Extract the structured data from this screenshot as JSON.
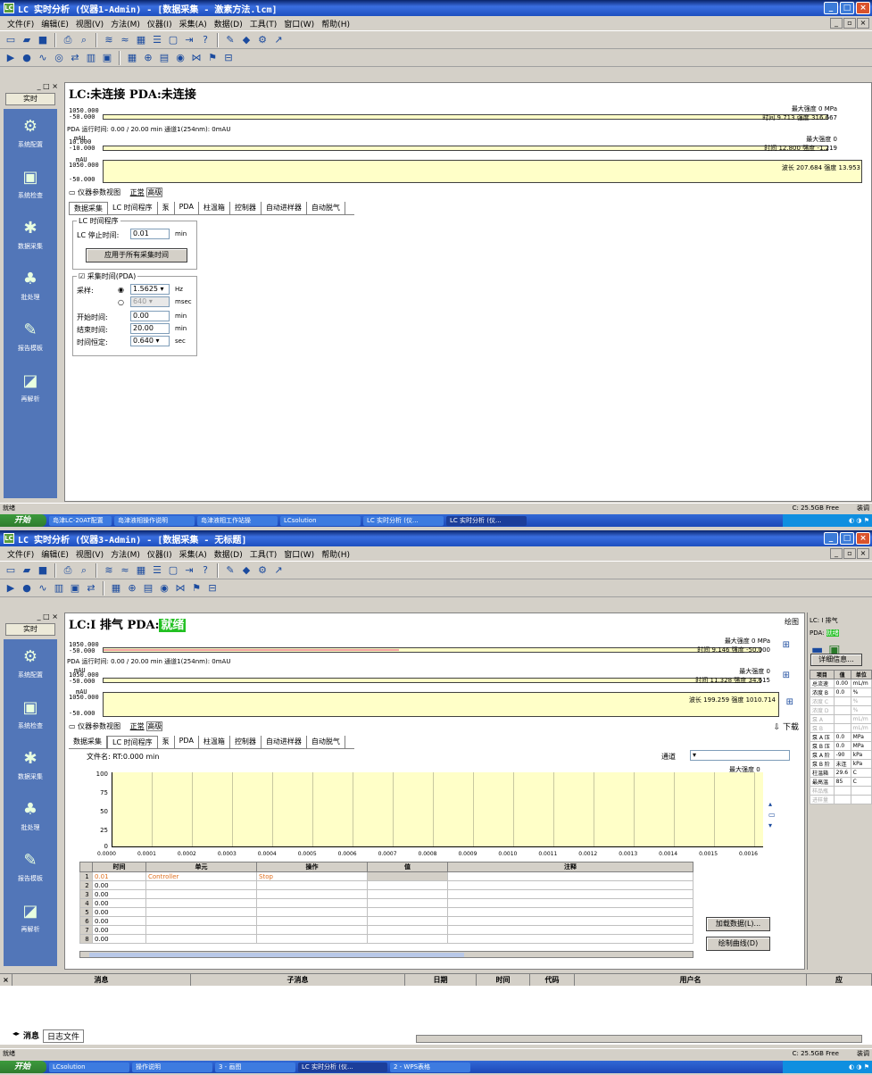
{
  "w1": {
    "title": "LC 实时分析 (仪器1-Admin) - [数据采集 - 激素方法.lcm]",
    "menu": [
      "文件(F)",
      "编辑(E)",
      "视图(V)",
      "方法(M)",
      "仪器(I)",
      "采集(A)",
      "数据(D)",
      "工具(T)",
      "窗口(W)",
      "帮助(H)"
    ],
    "leftbar": {
      "tab": "实时",
      "items": [
        "系统配置",
        "系统检查",
        "数据采集",
        "批处理",
        "报告模板",
        "再解析"
      ]
    },
    "status_lc": "LC:未连接",
    "status_pda": "PDA:未连接",
    "strip1": {
      "ytop": "1050.000",
      "ybot": "-50.000",
      "readout_time": "时间",
      "time_val": "9.713",
      "intensity_lbl": "强度",
      "int_val": "316.667",
      "max_lbl": "最大强度",
      "max_val": "0",
      "unit": "MPa"
    },
    "runinfo": "PDA 运行时间: 0.00 / 20.00 min 通道1(254nm): 0mAU",
    "strip2": {
      "unit": "mAU",
      "ytop": "10.000",
      "ybot": "-10.000",
      "max_lbl": "最大强度",
      "max_val": "0",
      "time_lbl": "时间",
      "time_val": "12.800",
      "int_lbl": "强度",
      "int_val": "-1.219"
    },
    "strip3": {
      "unit": "mAU",
      "ytop": "1050.000",
      "ybot": "-50.000",
      "wl_lbl": "波长",
      "wl_val": "207.684",
      "int_lbl": "强度",
      "int_val": "13.953"
    },
    "params_title": "仪器参数视图",
    "mode_normal": "正常",
    "mode_adv": "高级",
    "tabs": [
      "数据采集",
      "LC 时间程序",
      "泵",
      "PDA",
      "柱温箱",
      "控制器",
      "自动进样器",
      "自动脱气"
    ],
    "lc_group": "LC 时间程序",
    "stop_time_lbl": "LC 停止时间:",
    "stop_time_val": "0.01",
    "min": "min",
    "apply_btn": "应用于所有采集时间",
    "pda_group": "采集时间(PDA)",
    "sampling_lbl": "采样:",
    "sampling_val": "1.5625",
    "hz": "Hz",
    "msec_val": "640",
    "msec": "msec",
    "start_lbl": "开始时间:",
    "start_val": "0.00",
    "end_lbl": "结束时间:",
    "end_val": "20.00",
    "const_lbl": "时间恒定:",
    "const_val": "0.640",
    "sec": "sec",
    "statusbar_left": "就绪",
    "statusbar_right": "C: 25.5GB Free",
    "statusbar_far": "装调",
    "taskbar": {
      "start": "开始",
      "tasks": [
        "岛津LC-20AT配置",
        "岛津液相操作说明",
        "岛津液相工作站操",
        "LCsolution",
        "LC 实时分析 (仪...",
        "LC 实时分析 (仪..."
      ]
    }
  },
  "w2": {
    "title": "LC 实时分析 (仪器3-Admin) - [数据采集 - 无标题]",
    "menu": [
      "文件(F)",
      "编辑(E)",
      "视图(V)",
      "方法(M)",
      "仪器(I)",
      "采集(A)",
      "数据(D)",
      "工具(T)",
      "窗口(W)",
      "帮助(H)"
    ],
    "leftbar": {
      "tab": "实时",
      "items": [
        "系统配置",
        "系统检查",
        "数据采集",
        "批处理",
        "报告模板",
        "再解析"
      ]
    },
    "status_lc": "LC:I 排气",
    "status_pda": "PDA:",
    "status_pda_ok": "就绪",
    "draw_btn": "绘图",
    "strip1": {
      "ytop": "1050.000",
      "ybot": "-50.000",
      "max_lbl": "最大强度",
      "max_val": "0",
      "unit": "MPa",
      "time_lbl": "时间",
      "time_val": "9.146",
      "int_lbl": "强度",
      "int_val": "-50.000"
    },
    "runinfo": "PDA 运行时间: 0.00 / 20.00 min 通道1(254nm): 0mAU",
    "strip2": {
      "unit": "mAU",
      "ytop": "1050.000",
      "ybot": "-50.000",
      "max_lbl": "最大强度",
      "max_val": "0",
      "time_lbl": "时间",
      "time_val": "11.328",
      "int_lbl": "强度",
      "int_val": "34.615"
    },
    "strip3": {
      "unit": "mAU",
      "ytop": "1050.000",
      "ybot": "-50.000",
      "wl_lbl": "波长",
      "wl_val": "199.259",
      "int_lbl": "强度",
      "int_val": "1010.714"
    },
    "params_title": "仪器参数视图",
    "mode_normal": "正常",
    "mode_adv": "高级",
    "download_btn": "下载",
    "tabs": [
      "数据采集",
      "LC 时间程序",
      "泵",
      "PDA",
      "柱温箱",
      "控制器",
      "自动进样器",
      "自动脱气"
    ],
    "file_lbl": "文件名: RT:0.000 min",
    "channel_lbl": "通道",
    "graph_max_lbl": "最大强度",
    "graph_max_val": "0",
    "graph_yticks": [
      "100",
      "75",
      "50",
      "25",
      "0"
    ],
    "graph_xticks": [
      "0.0000",
      "0.0001",
      "0.0002",
      "0.0003",
      "0.0004",
      "0.0005",
      "0.0006",
      "0.0007",
      "0.0008",
      "0.0009",
      "0.0010",
      "0.0011",
      "0.0012",
      "0.0013",
      "0.0014",
      "0.0015",
      "0.0016"
    ],
    "table_head": [
      "时间",
      "单元",
      "操作",
      "值",
      "注释"
    ],
    "table_rows": [
      {
        "n": "1",
        "t": "0.01",
        "unit": "Controller",
        "op": "Stop"
      },
      {
        "n": "2",
        "t": "0.00",
        "unit": "",
        "op": ""
      },
      {
        "n": "3",
        "t": "0.00",
        "unit": "",
        "op": ""
      },
      {
        "n": "4",
        "t": "0.00",
        "unit": "",
        "op": ""
      },
      {
        "n": "5",
        "t": "0.00",
        "unit": "",
        "op": ""
      },
      {
        "n": "6",
        "t": "0.00",
        "unit": "",
        "op": ""
      },
      {
        "n": "7",
        "t": "0.00",
        "unit": "",
        "op": ""
      },
      {
        "n": "8",
        "t": "0.00",
        "unit": "",
        "op": ""
      }
    ],
    "load_btn": "加载数据(L)...",
    "plot_btn": "绘制曲线(D)",
    "right": {
      "lc": "LC: I 排气",
      "pda": "PDA:",
      "pda_ok": "就绪",
      "detail_btn": "详细信息...",
      "head": [
        "项目",
        "值",
        "单位"
      ],
      "rows": [
        [
          "总流速",
          "0.00",
          "mL/m"
        ],
        [
          "浓度 B",
          "0.0",
          "%"
        ],
        [
          "浓度 C",
          "",
          "%"
        ],
        [
          "浓度 D",
          "",
          "%"
        ],
        [
          "泵 A",
          "",
          "mL/m"
        ],
        [
          "泵 B",
          "",
          "mL/m"
        ],
        [
          "泵 A 压",
          "0.0",
          "MPa"
        ],
        [
          "泵 B 压",
          "0.0",
          "MPa"
        ],
        [
          "泵 A 阶",
          "-90",
          "kPa"
        ],
        [
          "泵 B 阶",
          "未连",
          "kPa"
        ],
        [
          "柱温箱",
          "29.6",
          "C"
        ],
        [
          "最高温",
          "85",
          "C"
        ],
        [
          "样品瓶",
          "",
          ""
        ],
        [
          "进样量",
          "",
          ""
        ]
      ]
    },
    "msg_head": [
      "消息",
      "子消息",
      "日期",
      "时间",
      "代码",
      "用户名",
      "应"
    ],
    "msg_tabs": [
      "消息",
      "日志文件"
    ],
    "statusbar_left": "就绪",
    "statusbar_right": "C: 25.5GB Free",
    "statusbar_far": "装调",
    "taskbar": {
      "start": "开始",
      "tasks": [
        "LCsolution",
        "操作说明",
        "3 - 画图",
        "LC 实时分析 (仪...",
        "2 - WPS表格"
      ]
    }
  }
}
